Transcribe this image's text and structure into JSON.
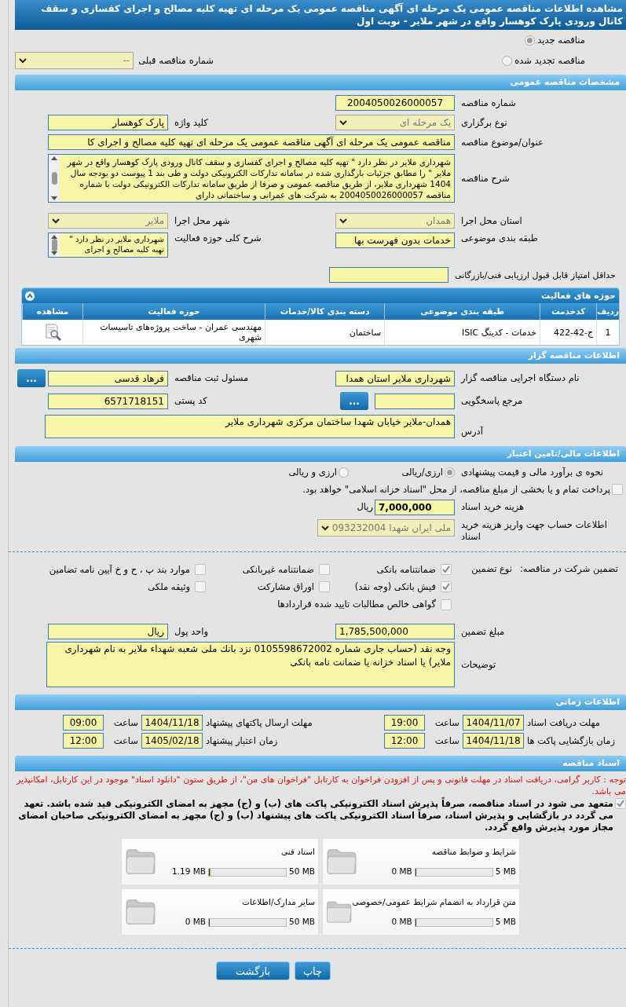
{
  "title": "مشاهده اطلاعات مناقصه عمومی یک مرحله ای آگهی مناقصه عمومی یک مرحله ای تهیه کلیه مصالح و اجرای کفسازی و سقف کانال ورودی پارک کوهسار واقع در شهر ملایر - نوبت اول",
  "tender_type": [
    {
      "label": "مناقصه جدید",
      "selected": true
    },
    {
      "label": "مناقصه تجدید شده",
      "selected": false
    }
  ],
  "previous_tender": {
    "label": "شماره مناقصه قبلی",
    "value": "--"
  },
  "general": {
    "heading": "مشخصات مناقصه عمومی",
    "tender_number": {
      "label": "شماره مناقصه",
      "value": "2004050026000057"
    },
    "holding_type": {
      "label": "نوع برگزاری",
      "value": "یک مرحله ای"
    },
    "keyword": {
      "label": "کلید واژه",
      "value": "پارک کوهسار"
    },
    "subject": {
      "label": "عنوان/موضوع مناقصه",
      "value": "مناقصه عمومی یک مرحله ای آگهی مناقصه عمومی یک مرحله ای تهیه کلیه مصالح و اجرای کا"
    },
    "description": {
      "label": "شرح مناقصه",
      "value": "شهرداری ملایر در نظر دارد \" تهیه کلیه مصالح و اجرای کفسازی و سقف کانال ورودی پارک کوهسار واقع در شهر ملایر \" را مطابق جزئیات بارگذاری شده در سامانه تدارکات الکترونیکی دولت و طی بند 1 پیوست دو بودجه سال 1404 شهرداری ملایر، از طریق مناقصه عمومی و صرفا از طریق سامانه تدارکات الکترونیکی دولت با شماره مناقصه 2004050026000057 به شرکت های عمرانی و ساختمانی دارای"
    },
    "province": {
      "label": "استان محل اجرا",
      "value": "همدان"
    },
    "city": {
      "label": "شهر محل اجرا",
      "value": "ملایر"
    },
    "category": {
      "label": "طبقه بندی موضوعی",
      "value": "خدمات بدون فهرست بها"
    },
    "activity_summary": {
      "label": "شرح کلی حوزه فعالیت",
      "value": "شهرداری ملایر در نظر دارد \" تهیه کلیه مصالح و اجرای"
    },
    "min_score": {
      "label": "حداقل امتیاز قابل قبول ارزیابی فنی/بازرگانی"
    }
  },
  "activities": {
    "heading": "حوزه های فعالیت",
    "expanded": true,
    "columns": [
      "ردیف",
      "کدخدمت",
      "طبقه بندی موضوعی",
      "دسته بندی کالا/خدمات",
      "حوزه فعالیت",
      "مشاهده"
    ],
    "rows": [
      [
        "1",
        "ج-42-422",
        "خدمات - کدینگ ISIC",
        "ساختمان",
        "مهندسی عمران - ساخت پروژه‌های تاسیسات شهری"
      ]
    ]
  },
  "organizer": {
    "heading": "اطلاعات مناقصه گزار",
    "agency": {
      "label": "نام دستگاه اجرایی مناقصه گزار",
      "value": "شهرداری ملایر استان همدا"
    },
    "registrar": {
      "label": "مسئول ثبت مناقصه",
      "value": "فرهاد قدسی",
      "button": "..."
    },
    "reference": {
      "label": "مرجع پاسخگویی",
      "button": "..."
    },
    "postal_code": {
      "label": "کد پستی",
      "value": "6571718151"
    },
    "address": {
      "label": "آدرس",
      "value": "همدان-ملایر خیابان شهدا ساختمان مرکزی شهرداری ملایر"
    }
  },
  "finance": {
    "heading": "اطلاعات مالی/تامین اعتبار",
    "estimate_label": "نحوه ی برآورد مالی و قیمت پیشنهادی",
    "estimate_options": [
      {
        "label": "ارزی/ریالی",
        "selected": true
      },
      {
        "label": "ارزی و ریالی",
        "selected": false
      }
    ],
    "treasury": {
      "label": "پرداخت تمام و یا بخشی از مبلغ مناقصه، از محل \"اسناد خزانه اسلامی\" خواهد بود.",
      "checked": false
    },
    "doc_fee": {
      "label": "هزینه خرید اسناد",
      "value": "7,000,000",
      "unit": "ریال"
    },
    "account": {
      "label": "اطلاعات حساب جهت واریز هزینه خرید اسناد",
      "value": "ملی ایران شهدا 093232004"
    }
  },
  "guarantee": {
    "label": "تضمین شرکت در مناقصه:",
    "type_label": "نوع تضمین",
    "options": [
      {
        "label": "ضمانتنامه بانکی",
        "checked": true
      },
      {
        "label": "ضمانتنامه غیربانکی",
        "checked": false
      },
      {
        "label": "موارد بند پ ، ح و خ آیین نامه تضامین",
        "checked": false
      },
      {
        "label": "فیش بانکی (وجه نقد)",
        "checked": true
      },
      {
        "label": "اوراق مشارکت",
        "checked": false
      },
      {
        "label": "وثیقه ملکی",
        "checked": false
      },
      {
        "label": "گواهی خالص مطالبات تایید شده قراردادها",
        "checked": false
      }
    ],
    "amount": {
      "label": "مبلغ تضمین",
      "value": "1,785,500,000"
    },
    "currency": {
      "label": "واحد پول",
      "value": "ریال"
    },
    "notes": {
      "label": "توضیحات",
      "value": "وجه نقد (حساب جاری شماره 0105598672002 نزد بانك ملی شعبه شهداء ملایر به نام شهرداری ملایر) یا اسناد خزانه یا ضمانت نامه بانکی"
    }
  },
  "timing": {
    "heading": "اطلاعات زمانی",
    "items": [
      {
        "label": "مهلت دریافت اسناد",
        "date": "1404/11/07",
        "time_label": "ساعت",
        "time": "19:00"
      },
      {
        "label": "مهلت ارسال پاکتهای پیشنهاد",
        "date": "1404/11/18",
        "time_label": "ساعت",
        "time": "09:00"
      },
      {
        "label": "زمان بازگشایی پاکت ها",
        "date": "1404/11/18",
        "time_label": "ساعت",
        "time": "12:00"
      },
      {
        "label": "زمان اعتبار پیشنهاد",
        "date": "1405/02/18",
        "time_label": "ساعت",
        "time": "12:00"
      }
    ]
  },
  "documents": {
    "heading": "اسناد مناقصه",
    "notice": "توجه : کاربر گرامی، دریافت اسناد در مهلت قانونی و پس از افزودن فراخوان به کارتابل \"فراخوان های من\"، از طریق ستون \"دانلود اسناد\" موجود در این کارتابل، امکانپذیر می باشد.",
    "commitment": {
      "text": "متعهد می شود در اسناد مناقصه، صرفاً پذیرش اسناد الکترونیکی پاکت های (ب) و (ج) مجهز به امضای الکترونیکی قید شده باشد. تعهد می گردد در بازگشایی و پذیرش اسناد، صرفاً اسناد الکترونیکی پاکت های پیشنهاد (ب) و (ج) مجهز به امضای الکترونیکی صاحبان امضای مجاز مورد پذیرش واقع گردد.",
      "checked": true
    },
    "files": [
      {
        "name": "شرایط و ضوابط مناقصه",
        "used": "0 MB",
        "max": "5 MB",
        "level": 0
      },
      {
        "name": "اسناد فنی",
        "used": "1.19 MB",
        "max": "50 MB",
        "level": 0.024
      },
      {
        "name": "متن قرارداد به انضمام شرایط عمومی/خصوصی",
        "used": "0 MB",
        "max": "5 MB",
        "level": 0
      },
      {
        "name": "سایر مدارک/اطلاعات",
        "used": "0 MB",
        "max": "50 MB",
        "level": 0
      }
    ]
  },
  "buttons": [
    {
      "label": "چاپ"
    },
    {
      "label": "بازگشت"
    }
  ]
}
